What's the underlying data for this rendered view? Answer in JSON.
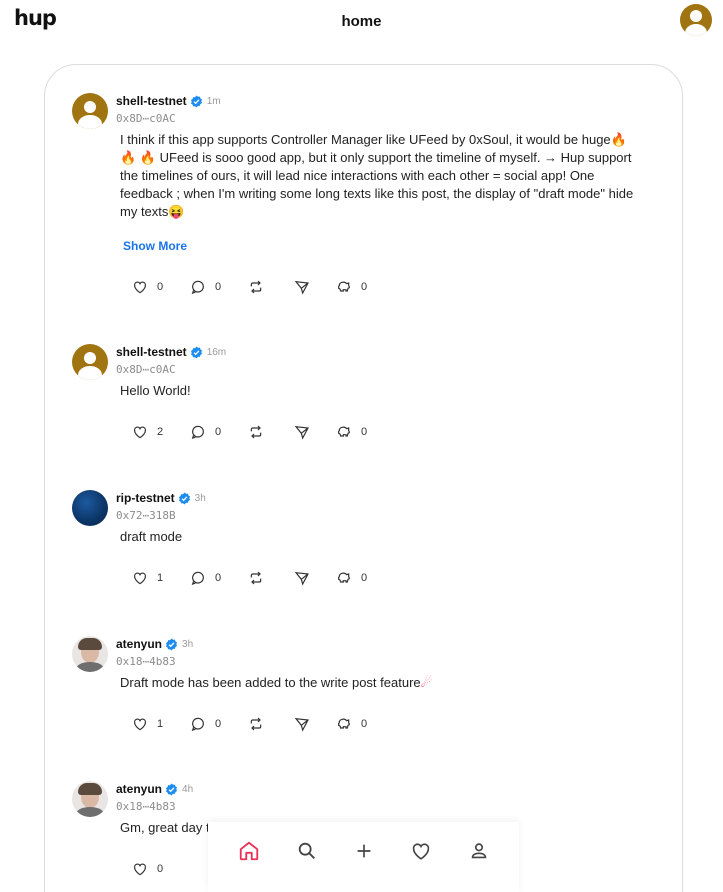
{
  "header": {
    "logo": "hup",
    "title": "home"
  },
  "posts": [
    {
      "username": "shell-testnet",
      "time": "1m",
      "address": "0x8D⋯c0AC",
      "text_lines": [
        "I think if this app supports Controller Manager like UFeed by 0xSoul, it would be huge",
        "UFeed is sooo good app, but it only support the timeline of myself. → Hup support",
        "the timelines of ours, it will lead nice interactions with each other = social app! One",
        "feedback ; when I'm writing some long texts like this post, the display of \"draft mode\" hide",
        "my texts"
      ],
      "show_more": "Show More",
      "likes": "0",
      "comments": "0",
      "tips": "0"
    },
    {
      "username": "shell-testnet",
      "time": "16m",
      "address": "0x8D⋯c0AC",
      "text": "Hello World!",
      "likes": "2",
      "comments": "0",
      "tips": "0"
    },
    {
      "username": "rip-testnet",
      "time": "3h",
      "address": "0x72⋯318B",
      "text": "draft mode",
      "likes": "1",
      "comments": "0",
      "tips": "0"
    },
    {
      "username": "atenyun",
      "time": "3h",
      "address": "0x18⋯4b83",
      "text": "Draft mode has been added to the write post feature",
      "likes": "1",
      "comments": "0",
      "tips": "0"
    },
    {
      "username": "atenyun",
      "time": "4h",
      "address": "0x18⋯4b83",
      "text": "Gm, great day t",
      "likes": "0"
    }
  ],
  "colors": {
    "accent": "#e8325a",
    "link": "#1a73e8",
    "verified": "#1d8cf0"
  },
  "bottom_nav": [
    "home-icon",
    "search-icon",
    "plus-icon",
    "heart-icon",
    "profile-icon"
  ]
}
